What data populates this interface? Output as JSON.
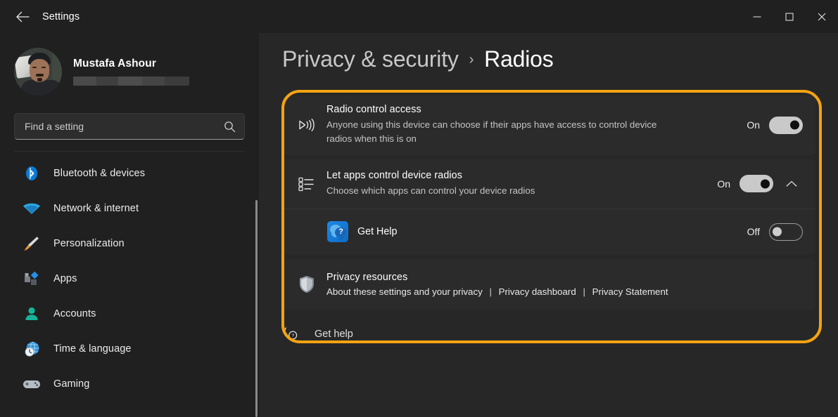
{
  "titlebar": {
    "back_label": "back-arrow",
    "app_title": "Settings",
    "minimize": "minimize",
    "maximize": "maximize",
    "close": "close"
  },
  "sidebar": {
    "profile": {
      "name": "Mustafa Ashour",
      "email_redacted": true
    },
    "search": {
      "placeholder": "Find a setting",
      "value": ""
    },
    "items": [
      {
        "label": "Bluetooth & devices",
        "icon": "bluetooth-icon"
      },
      {
        "label": "Network & internet",
        "icon": "wifi-icon"
      },
      {
        "label": "Personalization",
        "icon": "paintbrush-icon"
      },
      {
        "label": "Apps",
        "icon": "apps-icon"
      },
      {
        "label": "Accounts",
        "icon": "person-icon"
      },
      {
        "label": "Time & language",
        "icon": "clock-globe-icon"
      },
      {
        "label": "Gaming",
        "icon": "gamepad-icon"
      }
    ]
  },
  "main": {
    "breadcrumb": {
      "parent": "Privacy & security",
      "separator": "›",
      "current": "Radios"
    },
    "settings": [
      {
        "title": "Radio control access",
        "description": "Anyone using this device can choose if their apps have access to control device radios when this is on",
        "toggle_state": "On",
        "toggle_on": true,
        "icon": "radio-broadcast-icon"
      },
      {
        "title": "Let apps control device radios",
        "description": "Choose which apps can control your device radios",
        "toggle_state": "On",
        "toggle_on": true,
        "icon": "app-list-icon",
        "expanded": true,
        "chevron": "chevron-up-icon"
      }
    ],
    "app_entries": [
      {
        "name": "Get Help",
        "toggle_state": "Off",
        "toggle_on": false,
        "icon": "get-help-app-icon"
      }
    ],
    "privacy_resources": {
      "title": "Privacy resources",
      "icon": "shield-icon",
      "links": [
        "About these settings and your privacy",
        "Privacy dashboard",
        "Privacy Statement"
      ],
      "separator": "|"
    },
    "footer": {
      "get_help_label": "Get help",
      "icon": "help-bubble-icon"
    }
  },
  "highlight": {
    "color": "#f5a312"
  }
}
